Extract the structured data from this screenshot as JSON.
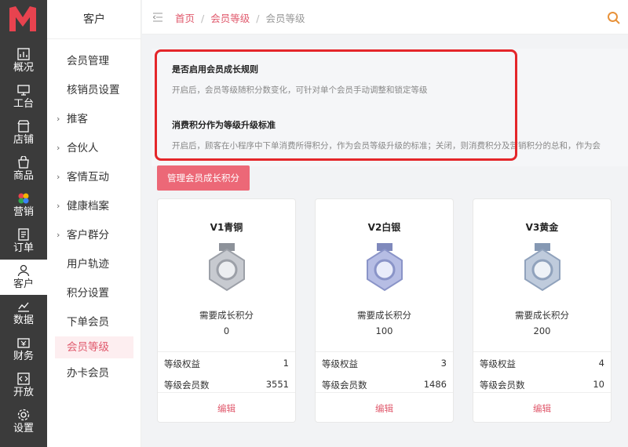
{
  "nav": {
    "items": [
      {
        "label": "概况",
        "icon": "overview-icon"
      },
      {
        "label": "工台",
        "icon": "desktop-icon"
      },
      {
        "label": "店铺",
        "icon": "store-icon"
      },
      {
        "label": "商品",
        "icon": "goods-icon"
      },
      {
        "label": "营销",
        "icon": "marketing-icon"
      },
      {
        "label": "订单",
        "icon": "order-icon"
      },
      {
        "label": "客户",
        "icon": "customer-icon"
      },
      {
        "label": "数据",
        "icon": "data-icon"
      },
      {
        "label": "财务",
        "icon": "finance-icon"
      },
      {
        "label": "开放",
        "icon": "open-icon"
      },
      {
        "label": "设置",
        "icon": "settings-icon"
      }
    ]
  },
  "subnav": {
    "title": "客户",
    "items": [
      {
        "label": "会员管理"
      },
      {
        "label": "核销员设置"
      },
      {
        "label": "推客",
        "chevron": "›"
      },
      {
        "label": "合伙人",
        "chevron": "›"
      },
      {
        "label": "客情互动",
        "chevron": "›"
      },
      {
        "label": "健康档案",
        "chevron": "›"
      },
      {
        "label": "客户群分",
        "chevron": "›"
      },
      {
        "label": "用户轨迹"
      },
      {
        "label": "积分设置"
      },
      {
        "label": "下单会员"
      },
      {
        "label": "会员等级"
      },
      {
        "label": "办卡会员"
      }
    ]
  },
  "breadcrumb": {
    "home": "首页",
    "parent": "会员等级",
    "current": "会员等级",
    "sep": "/"
  },
  "settings": {
    "rule_title": "是否启用会员成长规则",
    "rule_desc": "开启后，会员等级随积分数变化，可针对单个会员手动调整和锁定等级",
    "standard_title": "消费积分作为等级升级标准",
    "standard_desc": "开启后，顾客在小程序中下单消费所得积分，作为会员等级升级的标准；关闭，则消费积分及营销积分的总和，作为会"
  },
  "manage_button": "管理会员成长积分",
  "cards": [
    {
      "level": "V1青铜",
      "need_label": "需要成长积分",
      "points": "0",
      "rights_label": "等级权益",
      "rights": "1",
      "members_label": "等级会员数",
      "members": "3551",
      "edit": "编辑",
      "medal_color": "#b8bcc4"
    },
    {
      "level": "V2白银",
      "need_label": "需要成长积分",
      "points": "100",
      "rights_label": "等级权益",
      "rights": "3",
      "members_label": "等级会员数",
      "members": "1486",
      "edit": "编辑",
      "medal_color": "#9aa6d8"
    },
    {
      "level": "V3黄金",
      "need_label": "需要成长积分",
      "points": "200",
      "rights_label": "等级权益",
      "rights": "4",
      "members_label": "等级会员数",
      "members": "10",
      "edit": "编辑",
      "medal_color": "#a9b9cf"
    }
  ],
  "colors": {
    "accent": "#e05a6d",
    "button": "#ec6877",
    "highlight_box": "#e4262a",
    "nav_bg": "#3b3b3b"
  }
}
